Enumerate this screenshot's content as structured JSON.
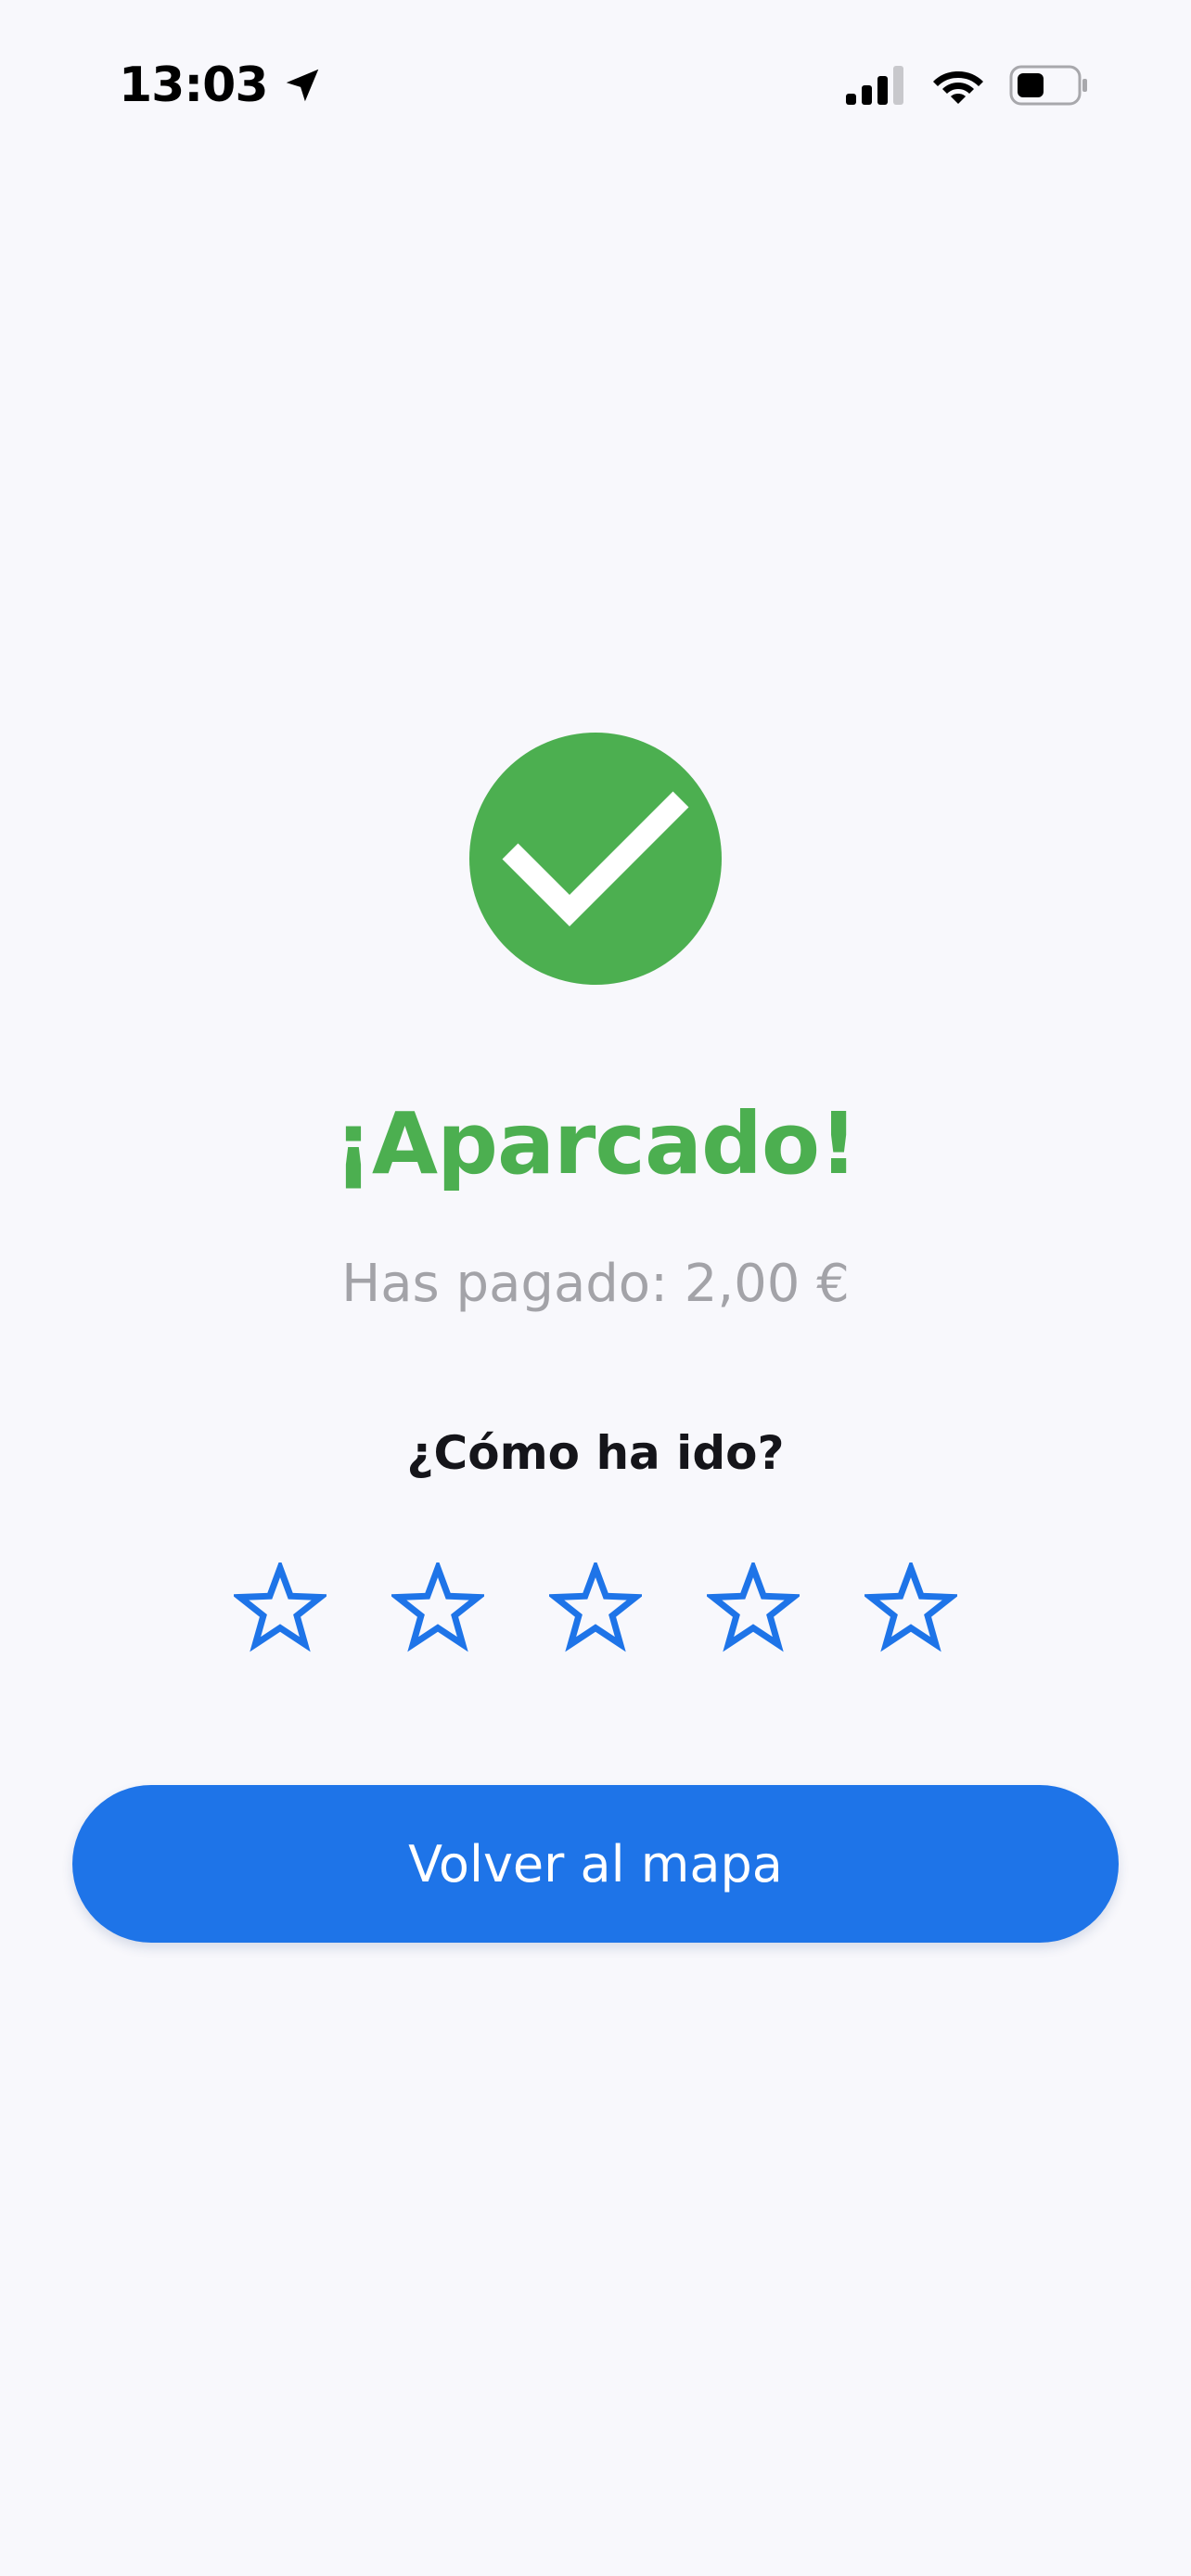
{
  "status_bar": {
    "time": "13:03",
    "icons": [
      "location-arrow-icon",
      "cellular-signal-icon",
      "wifi-icon",
      "battery-icon"
    ]
  },
  "success": {
    "icon": "check-circle-icon",
    "title": "¡Aparcado!",
    "paid_text": "Has pagado: 2,00 €"
  },
  "rating": {
    "question": "¿Cómo ha ido?",
    "max_stars": 5,
    "selected": 0,
    "icon": "star-outline-icon"
  },
  "actions": {
    "back_to_map_label": "Volver al mapa"
  },
  "colors": {
    "background": "#f8f8fc",
    "success_green": "#4caf50",
    "primary_blue": "#1e74e8",
    "muted_text": "#a3a3a8",
    "dark_text": "#15151a"
  }
}
